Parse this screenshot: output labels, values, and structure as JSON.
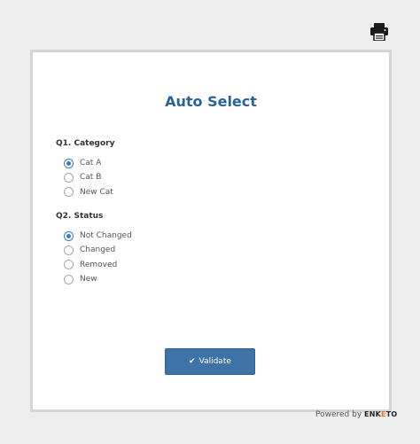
{
  "form": {
    "title": "Auto Select",
    "questions": [
      {
        "label": "Q1. Category",
        "options": [
          {
            "label": "Cat A",
            "checked": true
          },
          {
            "label": "Cat B",
            "checked": false
          },
          {
            "label": "New Cat",
            "checked": false
          }
        ]
      },
      {
        "label": "Q2. Status",
        "options": [
          {
            "label": "Not Changed",
            "checked": true
          },
          {
            "label": "Changed",
            "checked": false
          },
          {
            "label": "Removed",
            "checked": false
          },
          {
            "label": "New",
            "checked": false
          }
        ]
      }
    ],
    "validate_label": "Validate",
    "validate_icon": "check-icon"
  },
  "toolbar": {
    "print_icon": "printer-icon"
  },
  "footer": {
    "powered_by": "Powered by",
    "brand_start": "ENK",
    "brand_accent": "E",
    "brand_end": "TO"
  },
  "colors": {
    "title": "#2a6496",
    "button": "#3e73a8",
    "radio_checked": "#3a7bbf",
    "background": "#eeeeee",
    "card_border": "#d5d5d5"
  }
}
